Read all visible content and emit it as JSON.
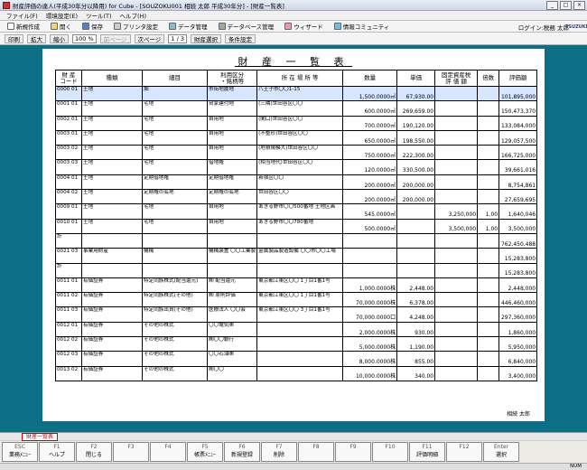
{
  "window": {
    "title": "財産評価の達人(平成30年分以降用) for Cube - [SOUZOKU001 相続 太郎 平成30年分] - [財産一覧表]"
  },
  "menu": [
    "ファイル(F)",
    "環境設定(E)",
    "ツール(T)",
    "ヘルプ(H)"
  ],
  "toolbar1": {
    "buttons": [
      "新規作成",
      "開く",
      "保存",
      "プリンタ設定",
      "データ管理",
      "データベース管理",
      "ウィザード",
      "情報コミュニティ"
    ],
    "login": "ログイン:税務 太郎",
    "logo": "TSUZUKI"
  },
  "toolbar2": {
    "print": "印刷",
    "zoom_in": "拡大",
    "zoom_out": "縮小",
    "zoom": "100 %",
    "prev": "前ページ",
    "next": "次ページ",
    "page": "1 / 3",
    "select": "財産選択",
    "condition": "条件設定"
  },
  "sheet": {
    "title": "財 産 一 覧 表",
    "headers": {
      "code": "財 産\nコード",
      "kind": "種類",
      "detail": "細目",
      "use": "利用区分\n・銘柄等",
      "loc": "所 在 場 所 等",
      "qty": "数量",
      "unit": "単価",
      "fixed": "固定資産税\n評 価 額",
      "mult": "倍数",
      "val": "評価額"
    },
    "owner": "相続 太郎"
  },
  "rows": [
    {
      "code": "0000 01",
      "kind": "土地",
      "detail": "畑",
      "use": "市街地農地",
      "loc": "八王子市〇〇1-15",
      "qty": "1,500.0000㎡",
      "unit": "67,930.00",
      "fixed": "",
      "mult": "",
      "val": "101,895,000"
    },
    {
      "code": "0001 01",
      "kind": "土地",
      "detail": "宅地",
      "use": "貸家建付地",
      "loc": "(三隣)世田谷区〇〇",
      "qty": "600.0000㎡",
      "unit": "269,659.00",
      "fixed": "",
      "mult": "",
      "val": "150,473,370"
    },
    {
      "code": "0002 01",
      "kind": "土地",
      "detail": "宅地",
      "use": "自用地",
      "loc": "(間口)世田谷区〇〇",
      "qty": "700.0000㎡",
      "unit": "190,120.00",
      "fixed": "",
      "mult": "",
      "val": "133,084,000"
    },
    {
      "code": "0003 01",
      "kind": "土地",
      "detail": "宅地",
      "use": "自用地",
      "loc": "(不整形)世田谷区〇〇",
      "qty": "650.0000㎡",
      "unit": "198,550.00",
      "fixed": "",
      "mult": "",
      "val": "129,057,500"
    },
    {
      "code": "0003 02",
      "kind": "土地",
      "detail": "宅地",
      "use": "自用地",
      "loc": "(地積規模大)世田谷区〇〇",
      "qty": "750.0000㎡",
      "unit": "222,300.00",
      "fixed": "",
      "mult": "",
      "val": "166,725,000"
    },
    {
      "code": "0003 03",
      "kind": "土地",
      "detail": "宅地",
      "use": "借地権",
      "loc": "(相当地代)世田谷区〇〇",
      "qty": "120.0000㎡",
      "unit": "330,500.00",
      "fixed": "",
      "mult": "",
      "val": "39,661,016"
    },
    {
      "code": "0004 01",
      "kind": "土地",
      "detail": "定期借地権",
      "use": "定期借地権",
      "loc": "新宿区〇〇",
      "qty": "200.0000㎡",
      "unit": "200,000.00",
      "fixed": "",
      "mult": "",
      "val": "8,754,861"
    },
    {
      "code": "0004 02",
      "kind": "土地",
      "detail": "定期権の底地",
      "use": "定期権の底地",
      "loc": "世田谷区〇〇",
      "qty": "200.0000㎡",
      "unit": "200,000.00",
      "fixed": "",
      "mult": "",
      "val": "27,659,695"
    },
    {
      "code": "0009 01",
      "kind": "土地",
      "detail": "宅地",
      "use": "自用地",
      "loc": "あきる野市〇〇500番地 土地区画",
      "qty": "545.0000㎡",
      "unit": "",
      "fixed": "3,250,000",
      "mult": "1.00",
      "val": "1,640,046"
    },
    {
      "code": "0010 01",
      "kind": "土地",
      "detail": "宅地",
      "use": "自用地",
      "loc": "あきる野市〇〇780番地",
      "qty": "500.0000㎡",
      "unit": "",
      "fixed": "3,500,000",
      "mult": "1.00",
      "val": "3,500,000"
    },
    {
      "code": "計",
      "kind": "",
      "detail": "",
      "use": "",
      "loc": "",
      "qty": "",
      "unit": "",
      "fixed": "",
      "mult": "",
      "val": "762,450,488"
    },
    {
      "code": "0021 03",
      "kind": "事業用財産",
      "detail": "機械",
      "use": "機械装置 〇〇工業製",
      "loc": "金属製品製造設備 〇〇市〇〇工場",
      "qty": "",
      "unit": "",
      "fixed": "",
      "mult": "",
      "val": "15,283,800"
    },
    {
      "code": "計",
      "kind": "",
      "detail": "",
      "use": "",
      "loc": "",
      "qty": "",
      "unit": "",
      "fixed": "",
      "mult": "",
      "val": "15,283,800"
    },
    {
      "code": "0011 01",
      "kind": "有価証券",
      "detail": "特定同族株式(配当還元)",
      "use": "㈱ 配当還元",
      "loc": "東京都江東区〇〇 1丁目1番1号",
      "qty": "1,000.0000株",
      "unit": "2,448.00",
      "fixed": "",
      "mult": "",
      "val": "2,448,000"
    },
    {
      "code": "0011 02",
      "kind": "有価証券",
      "detail": "特定同族株式(その他)",
      "use": "㈱ 原則評価",
      "loc": "東京都江東区〇〇 1丁目1番1号",
      "qty": "70,000.0000株",
      "unit": "6,378.00",
      "fixed": "",
      "mult": "",
      "val": "446,460,000"
    },
    {
      "code": "0011 03",
      "kind": "有価証券",
      "detail": "特定同族出資(その他)",
      "use": "医療法人 〇〇会",
      "loc": "東京都江東区〇〇 3丁目1番1号",
      "qty": "70,000.0000口",
      "unit": "4,248.00",
      "fixed": "",
      "mult": "",
      "val": "297,360,000"
    },
    {
      "code": "0012 01",
      "kind": "有価証券",
      "detail": "その他の株式",
      "use": "〇〇電気㈱",
      "loc": "",
      "qty": "2,000.0000株",
      "unit": "930.00",
      "fixed": "",
      "mult": "",
      "val": "1,860,000"
    },
    {
      "code": "0012 02",
      "kind": "有価証券",
      "detail": "その他の株式",
      "use": "㈱〇〇銀行",
      "loc": "",
      "qty": "5,000.0000株",
      "unit": "1,190.00",
      "fixed": "",
      "mult": "",
      "val": "5,950,000"
    },
    {
      "code": "0012 03",
      "kind": "有価証券",
      "detail": "その他の株式",
      "use": "〇〇石油㈱",
      "loc": "",
      "qty": "8,000.0000株",
      "unit": "855.00",
      "fixed": "",
      "mult": "",
      "val": "6,840,000"
    },
    {
      "code": "0013 02",
      "kind": "有価証券",
      "detail": "その他の株式",
      "use": "㈱〇〇",
      "loc": "",
      "qty": "10,000.0000株",
      "unit": "340.00",
      "fixed": "",
      "mult": "",
      "val": "3,400,000"
    }
  ],
  "status_tab": "財産一覧表",
  "fkeys": [
    {
      "k": "ESC",
      "l": "業務ﾒﾆｭｰ"
    },
    {
      "k": "F1",
      "l": "ヘルプ"
    },
    {
      "k": "F2",
      "l": "閉じる"
    },
    {
      "k": "F3",
      "l": ""
    },
    {
      "k": "F4",
      "l": ""
    },
    {
      "k": "F5",
      "l": "帳票ﾒﾆｭｰ"
    },
    {
      "k": "F6",
      "l": "新規登録"
    },
    {
      "k": "F7",
      "l": "削除"
    },
    {
      "k": "F8",
      "l": ""
    },
    {
      "k": "F9",
      "l": ""
    },
    {
      "k": "F10",
      "l": ""
    },
    {
      "k": "F11",
      "l": "評価明細"
    },
    {
      "k": "F12",
      "l": ""
    },
    {
      "k": "Enter",
      "l": "選択"
    }
  ],
  "indicator": "NUM"
}
